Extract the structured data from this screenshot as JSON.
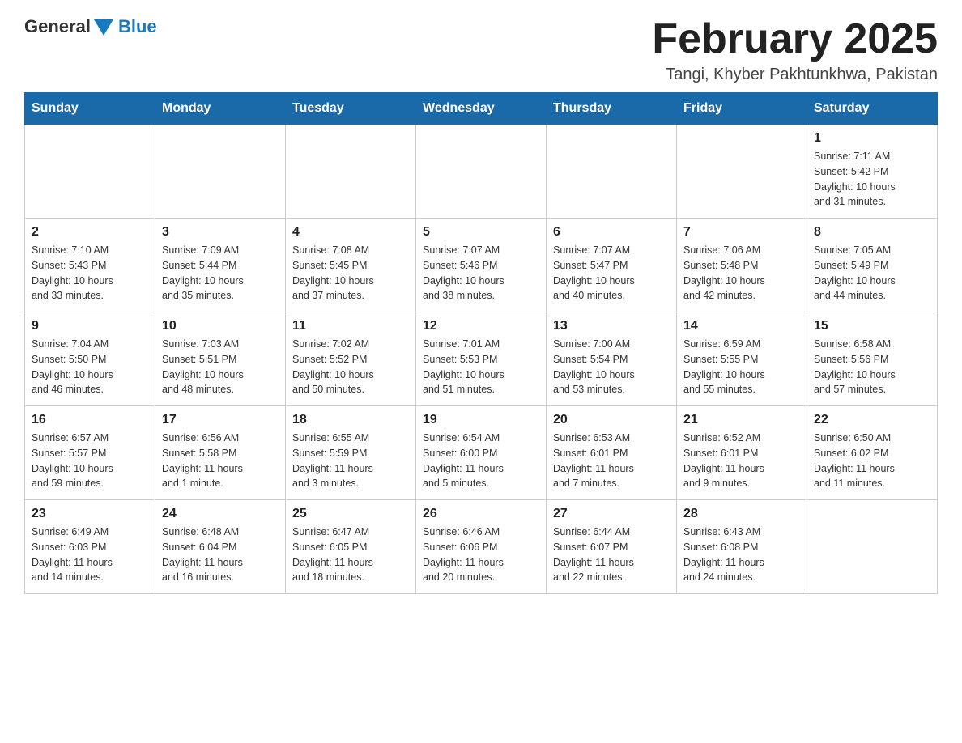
{
  "header": {
    "logo": {
      "general": "General",
      "blue": "Blue"
    },
    "month_title": "February 2025",
    "location": "Tangi, Khyber Pakhtunkhwa, Pakistan"
  },
  "days_of_week": [
    "Sunday",
    "Monday",
    "Tuesday",
    "Wednesday",
    "Thursday",
    "Friday",
    "Saturday"
  ],
  "weeks": [
    [
      {
        "day": "",
        "info": ""
      },
      {
        "day": "",
        "info": ""
      },
      {
        "day": "",
        "info": ""
      },
      {
        "day": "",
        "info": ""
      },
      {
        "day": "",
        "info": ""
      },
      {
        "day": "",
        "info": ""
      },
      {
        "day": "1",
        "info": "Sunrise: 7:11 AM\nSunset: 5:42 PM\nDaylight: 10 hours\nand 31 minutes."
      }
    ],
    [
      {
        "day": "2",
        "info": "Sunrise: 7:10 AM\nSunset: 5:43 PM\nDaylight: 10 hours\nand 33 minutes."
      },
      {
        "day": "3",
        "info": "Sunrise: 7:09 AM\nSunset: 5:44 PM\nDaylight: 10 hours\nand 35 minutes."
      },
      {
        "day": "4",
        "info": "Sunrise: 7:08 AM\nSunset: 5:45 PM\nDaylight: 10 hours\nand 37 minutes."
      },
      {
        "day": "5",
        "info": "Sunrise: 7:07 AM\nSunset: 5:46 PM\nDaylight: 10 hours\nand 38 minutes."
      },
      {
        "day": "6",
        "info": "Sunrise: 7:07 AM\nSunset: 5:47 PM\nDaylight: 10 hours\nand 40 minutes."
      },
      {
        "day": "7",
        "info": "Sunrise: 7:06 AM\nSunset: 5:48 PM\nDaylight: 10 hours\nand 42 minutes."
      },
      {
        "day": "8",
        "info": "Sunrise: 7:05 AM\nSunset: 5:49 PM\nDaylight: 10 hours\nand 44 minutes."
      }
    ],
    [
      {
        "day": "9",
        "info": "Sunrise: 7:04 AM\nSunset: 5:50 PM\nDaylight: 10 hours\nand 46 minutes."
      },
      {
        "day": "10",
        "info": "Sunrise: 7:03 AM\nSunset: 5:51 PM\nDaylight: 10 hours\nand 48 minutes."
      },
      {
        "day": "11",
        "info": "Sunrise: 7:02 AM\nSunset: 5:52 PM\nDaylight: 10 hours\nand 50 minutes."
      },
      {
        "day": "12",
        "info": "Sunrise: 7:01 AM\nSunset: 5:53 PM\nDaylight: 10 hours\nand 51 minutes."
      },
      {
        "day": "13",
        "info": "Sunrise: 7:00 AM\nSunset: 5:54 PM\nDaylight: 10 hours\nand 53 minutes."
      },
      {
        "day": "14",
        "info": "Sunrise: 6:59 AM\nSunset: 5:55 PM\nDaylight: 10 hours\nand 55 minutes."
      },
      {
        "day": "15",
        "info": "Sunrise: 6:58 AM\nSunset: 5:56 PM\nDaylight: 10 hours\nand 57 minutes."
      }
    ],
    [
      {
        "day": "16",
        "info": "Sunrise: 6:57 AM\nSunset: 5:57 PM\nDaylight: 10 hours\nand 59 minutes."
      },
      {
        "day": "17",
        "info": "Sunrise: 6:56 AM\nSunset: 5:58 PM\nDaylight: 11 hours\nand 1 minute."
      },
      {
        "day": "18",
        "info": "Sunrise: 6:55 AM\nSunset: 5:59 PM\nDaylight: 11 hours\nand 3 minutes."
      },
      {
        "day": "19",
        "info": "Sunrise: 6:54 AM\nSunset: 6:00 PM\nDaylight: 11 hours\nand 5 minutes."
      },
      {
        "day": "20",
        "info": "Sunrise: 6:53 AM\nSunset: 6:01 PM\nDaylight: 11 hours\nand 7 minutes."
      },
      {
        "day": "21",
        "info": "Sunrise: 6:52 AM\nSunset: 6:01 PM\nDaylight: 11 hours\nand 9 minutes."
      },
      {
        "day": "22",
        "info": "Sunrise: 6:50 AM\nSunset: 6:02 PM\nDaylight: 11 hours\nand 11 minutes."
      }
    ],
    [
      {
        "day": "23",
        "info": "Sunrise: 6:49 AM\nSunset: 6:03 PM\nDaylight: 11 hours\nand 14 minutes."
      },
      {
        "day": "24",
        "info": "Sunrise: 6:48 AM\nSunset: 6:04 PM\nDaylight: 11 hours\nand 16 minutes."
      },
      {
        "day": "25",
        "info": "Sunrise: 6:47 AM\nSunset: 6:05 PM\nDaylight: 11 hours\nand 18 minutes."
      },
      {
        "day": "26",
        "info": "Sunrise: 6:46 AM\nSunset: 6:06 PM\nDaylight: 11 hours\nand 20 minutes."
      },
      {
        "day": "27",
        "info": "Sunrise: 6:44 AM\nSunset: 6:07 PM\nDaylight: 11 hours\nand 22 minutes."
      },
      {
        "day": "28",
        "info": "Sunrise: 6:43 AM\nSunset: 6:08 PM\nDaylight: 11 hours\nand 24 minutes."
      },
      {
        "day": "",
        "info": ""
      }
    ]
  ]
}
